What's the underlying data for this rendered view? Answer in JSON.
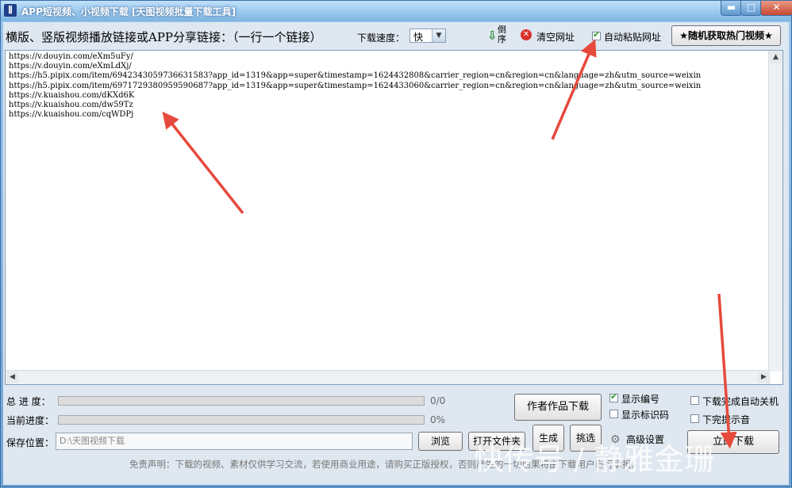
{
  "window": {
    "title": "APP短视频、小视频下载 [天图视频批量下载工具]",
    "icon": "app-logo-icon",
    "controls": {
      "minimize": "▬",
      "maximize": "□",
      "close": "✕"
    }
  },
  "toolbar": {
    "instruction": "横版、竖版视频播放链接或APP分享链接：（一行一个链接）",
    "speed_label": "下载速度：",
    "speed_value": "快",
    "reverse_label": "倒序",
    "clear_label": "清空网址",
    "auto_paste_label": "自动粘贴网址",
    "auto_paste_checked": true,
    "hot_video_button": "★随机获取热门视频★"
  },
  "links": [
    "https://v.douyin.com/eXm5uFy/",
    "https://v.douyin.com/eXmLdXj/",
    "https://h5.pipix.com/item/6942343059736631583?app_id=1319&app=super&timestamp=1624432808&carrier_region=cn&region=cn&language=zh&utm_source=weixin",
    "https://h5.pipix.com/item/6971729380959590687?app_id=1319&app=super&timestamp=1624433060&carrier_region=cn&region=cn&language=zh&utm_source=weixin",
    "https://v.kuaishou.com/dKXd6K",
    "https://v.kuaishou.com/dw59Tz",
    "https://v.kuaishou.com/cqWDPj"
  ],
  "progress": {
    "total_label": "总 进 度：",
    "total_value": "0/0",
    "total_fraction": 0,
    "current_label": "当前进度：",
    "current_value": "0%",
    "current_fraction": 0
  },
  "save": {
    "label": "保存位置：",
    "path": "D:\\天图视频下载",
    "browse_button": "浏览",
    "open_folder_button": "打开文件夹"
  },
  "actions": {
    "author_works_button": "作者作品下载",
    "generate_button": "生成",
    "pick_button": "挑选",
    "advanced_settings": "高级设置",
    "download_now_button": "立即下载"
  },
  "options": {
    "show_number": {
      "label": "显示编号",
      "checked": true
    },
    "show_id": {
      "label": "显示标识码",
      "checked": false
    },
    "auto_shutdown": {
      "label": "下载完成自动关机",
      "checked": false
    },
    "sound_on_finish": {
      "label": "下完提示音",
      "checked": false
    }
  },
  "disclaimer": "免责声明：下载的视频、素材仅供学习交流，若使用商业用途，请购买正版授权，否则产生的一切后果将由下载用户自行承担。",
  "watermark": "快传号 / 静雅金珊",
  "colors": {
    "arrow": "#e64a3c",
    "progress_fill": "#3db83d",
    "title_bar": "#7eb4e2"
  }
}
